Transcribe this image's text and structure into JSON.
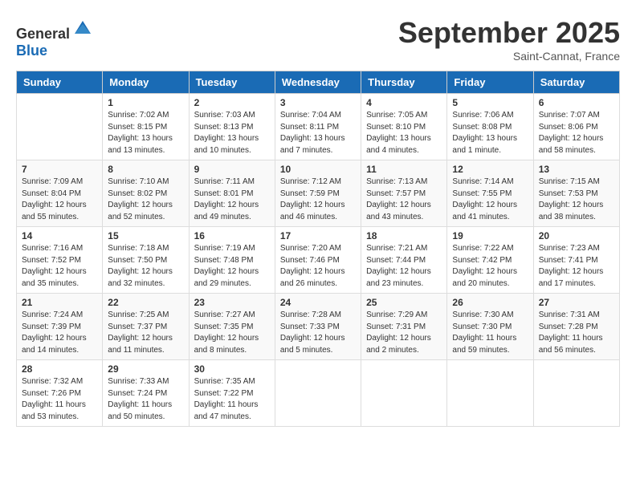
{
  "header": {
    "logo_general": "General",
    "logo_blue": "Blue",
    "month_title": "September 2025",
    "location": "Saint-Cannat, France"
  },
  "columns": [
    "Sunday",
    "Monday",
    "Tuesday",
    "Wednesday",
    "Thursday",
    "Friday",
    "Saturday"
  ],
  "weeks": [
    [
      {
        "day": "",
        "info": ""
      },
      {
        "day": "1",
        "info": "Sunrise: 7:02 AM\nSunset: 8:15 PM\nDaylight: 13 hours\nand 13 minutes."
      },
      {
        "day": "2",
        "info": "Sunrise: 7:03 AM\nSunset: 8:13 PM\nDaylight: 13 hours\nand 10 minutes."
      },
      {
        "day": "3",
        "info": "Sunrise: 7:04 AM\nSunset: 8:11 PM\nDaylight: 13 hours\nand 7 minutes."
      },
      {
        "day": "4",
        "info": "Sunrise: 7:05 AM\nSunset: 8:10 PM\nDaylight: 13 hours\nand 4 minutes."
      },
      {
        "day": "5",
        "info": "Sunrise: 7:06 AM\nSunset: 8:08 PM\nDaylight: 13 hours\nand 1 minute."
      },
      {
        "day": "6",
        "info": "Sunrise: 7:07 AM\nSunset: 8:06 PM\nDaylight: 12 hours\nand 58 minutes."
      }
    ],
    [
      {
        "day": "7",
        "info": "Sunrise: 7:09 AM\nSunset: 8:04 PM\nDaylight: 12 hours\nand 55 minutes."
      },
      {
        "day": "8",
        "info": "Sunrise: 7:10 AM\nSunset: 8:02 PM\nDaylight: 12 hours\nand 52 minutes."
      },
      {
        "day": "9",
        "info": "Sunrise: 7:11 AM\nSunset: 8:01 PM\nDaylight: 12 hours\nand 49 minutes."
      },
      {
        "day": "10",
        "info": "Sunrise: 7:12 AM\nSunset: 7:59 PM\nDaylight: 12 hours\nand 46 minutes."
      },
      {
        "day": "11",
        "info": "Sunrise: 7:13 AM\nSunset: 7:57 PM\nDaylight: 12 hours\nand 43 minutes."
      },
      {
        "day": "12",
        "info": "Sunrise: 7:14 AM\nSunset: 7:55 PM\nDaylight: 12 hours\nand 41 minutes."
      },
      {
        "day": "13",
        "info": "Sunrise: 7:15 AM\nSunset: 7:53 PM\nDaylight: 12 hours\nand 38 minutes."
      }
    ],
    [
      {
        "day": "14",
        "info": "Sunrise: 7:16 AM\nSunset: 7:52 PM\nDaylight: 12 hours\nand 35 minutes."
      },
      {
        "day": "15",
        "info": "Sunrise: 7:18 AM\nSunset: 7:50 PM\nDaylight: 12 hours\nand 32 minutes."
      },
      {
        "day": "16",
        "info": "Sunrise: 7:19 AM\nSunset: 7:48 PM\nDaylight: 12 hours\nand 29 minutes."
      },
      {
        "day": "17",
        "info": "Sunrise: 7:20 AM\nSunset: 7:46 PM\nDaylight: 12 hours\nand 26 minutes."
      },
      {
        "day": "18",
        "info": "Sunrise: 7:21 AM\nSunset: 7:44 PM\nDaylight: 12 hours\nand 23 minutes."
      },
      {
        "day": "19",
        "info": "Sunrise: 7:22 AM\nSunset: 7:42 PM\nDaylight: 12 hours\nand 20 minutes."
      },
      {
        "day": "20",
        "info": "Sunrise: 7:23 AM\nSunset: 7:41 PM\nDaylight: 12 hours\nand 17 minutes."
      }
    ],
    [
      {
        "day": "21",
        "info": "Sunrise: 7:24 AM\nSunset: 7:39 PM\nDaylight: 12 hours\nand 14 minutes."
      },
      {
        "day": "22",
        "info": "Sunrise: 7:25 AM\nSunset: 7:37 PM\nDaylight: 12 hours\nand 11 minutes."
      },
      {
        "day": "23",
        "info": "Sunrise: 7:27 AM\nSunset: 7:35 PM\nDaylight: 12 hours\nand 8 minutes."
      },
      {
        "day": "24",
        "info": "Sunrise: 7:28 AM\nSunset: 7:33 PM\nDaylight: 12 hours\nand 5 minutes."
      },
      {
        "day": "25",
        "info": "Sunrise: 7:29 AM\nSunset: 7:31 PM\nDaylight: 12 hours\nand 2 minutes."
      },
      {
        "day": "26",
        "info": "Sunrise: 7:30 AM\nSunset: 7:30 PM\nDaylight: 11 hours\nand 59 minutes."
      },
      {
        "day": "27",
        "info": "Sunrise: 7:31 AM\nSunset: 7:28 PM\nDaylight: 11 hours\nand 56 minutes."
      }
    ],
    [
      {
        "day": "28",
        "info": "Sunrise: 7:32 AM\nSunset: 7:26 PM\nDaylight: 11 hours\nand 53 minutes."
      },
      {
        "day": "29",
        "info": "Sunrise: 7:33 AM\nSunset: 7:24 PM\nDaylight: 11 hours\nand 50 minutes."
      },
      {
        "day": "30",
        "info": "Sunrise: 7:35 AM\nSunset: 7:22 PM\nDaylight: 11 hours\nand 47 minutes."
      },
      {
        "day": "",
        "info": ""
      },
      {
        "day": "",
        "info": ""
      },
      {
        "day": "",
        "info": ""
      },
      {
        "day": "",
        "info": ""
      }
    ]
  ]
}
